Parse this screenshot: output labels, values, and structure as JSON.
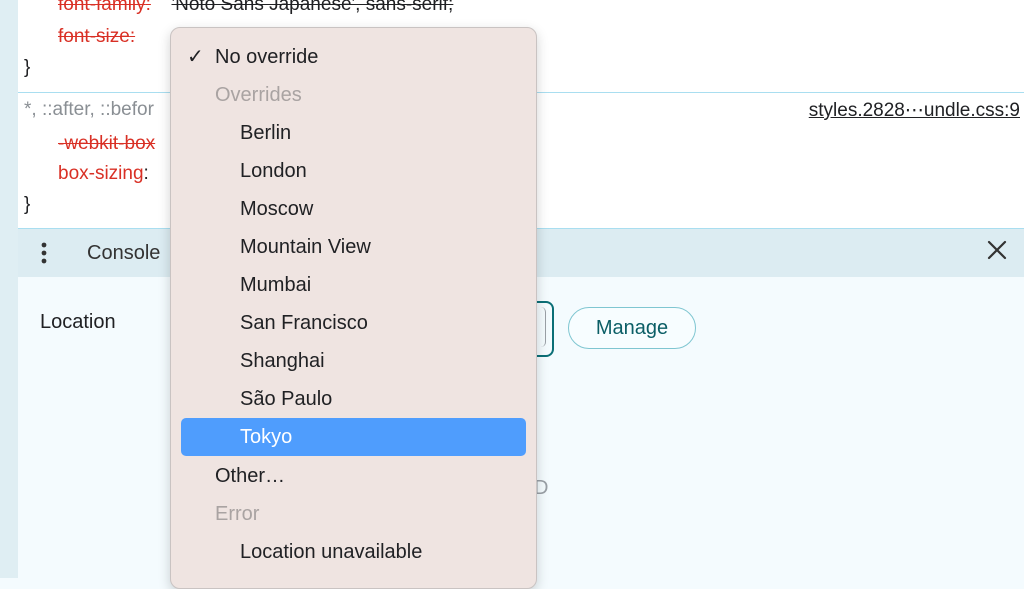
{
  "styles": {
    "rule1": {
      "prop1": "font-family",
      "val1": "'Noto Sans Japanese', sans-serif;",
      "prop2": "font-size",
      "val2": ""
    },
    "brace_close": "}",
    "rule2": {
      "selector": "*, ::after, ::befor",
      "source": "styles.2828⋯undle.css:9",
      "prop1": "-webkit-box",
      "prop2": "box-sizing"
    }
  },
  "drawer": {
    "tab_label": "Console",
    "close_icon": "close-icon",
    "kebab_icon": "more-vertical-icon"
  },
  "sensors": {
    "location_label": "Location",
    "manage_label": "Manage",
    "truncated_text": "D"
  },
  "dropdown": {
    "checkmark": "✓",
    "items": [
      {
        "label": "No override",
        "kind": "normal",
        "checked": true
      },
      {
        "label": "Overrides",
        "kind": "header"
      },
      {
        "label": "Berlin",
        "kind": "option"
      },
      {
        "label": "London",
        "kind": "option"
      },
      {
        "label": "Moscow",
        "kind": "option"
      },
      {
        "label": "Mountain View",
        "kind": "option"
      },
      {
        "label": "Mumbai",
        "kind": "option"
      },
      {
        "label": "San Francisco",
        "kind": "option"
      },
      {
        "label": "Shanghai",
        "kind": "option"
      },
      {
        "label": "São Paulo",
        "kind": "option"
      },
      {
        "label": "Tokyo",
        "kind": "option",
        "highlighted": true
      },
      {
        "label": "Other…",
        "kind": "normal"
      },
      {
        "label": "Error",
        "kind": "header"
      },
      {
        "label": "Location unavailable",
        "kind": "option"
      }
    ]
  },
  "colors": {
    "highlight": "#4f9dfd",
    "struck_property": "#d93025",
    "accent": "#0b6f76"
  }
}
